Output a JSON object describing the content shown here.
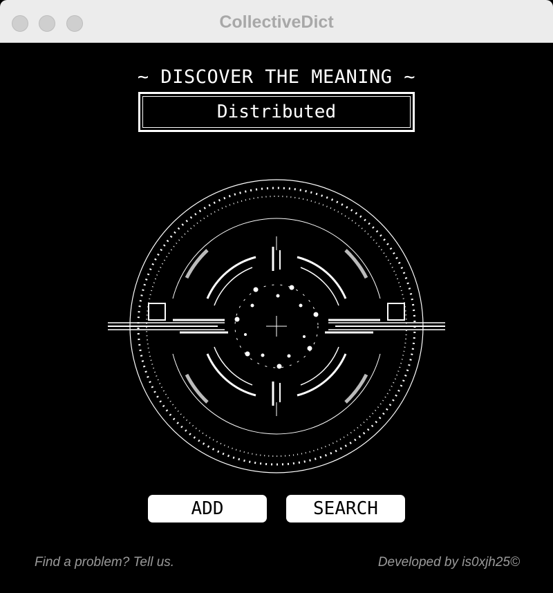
{
  "window": {
    "title": "CollectiveDict"
  },
  "main": {
    "heading": "~ DISCOVER THE MEANING ~",
    "word_value": "Distributed"
  },
  "buttons": {
    "add_label": "ADD",
    "search_label": "SEARCH"
  },
  "footer": {
    "feedback_link": "Find a problem? Tell us.",
    "credit": "Developed by is0xjh25©"
  },
  "colors": {
    "background": "#000000",
    "foreground": "#ffffff",
    "titlebar": "#ececec",
    "footer_text": "#9a9a9a"
  }
}
